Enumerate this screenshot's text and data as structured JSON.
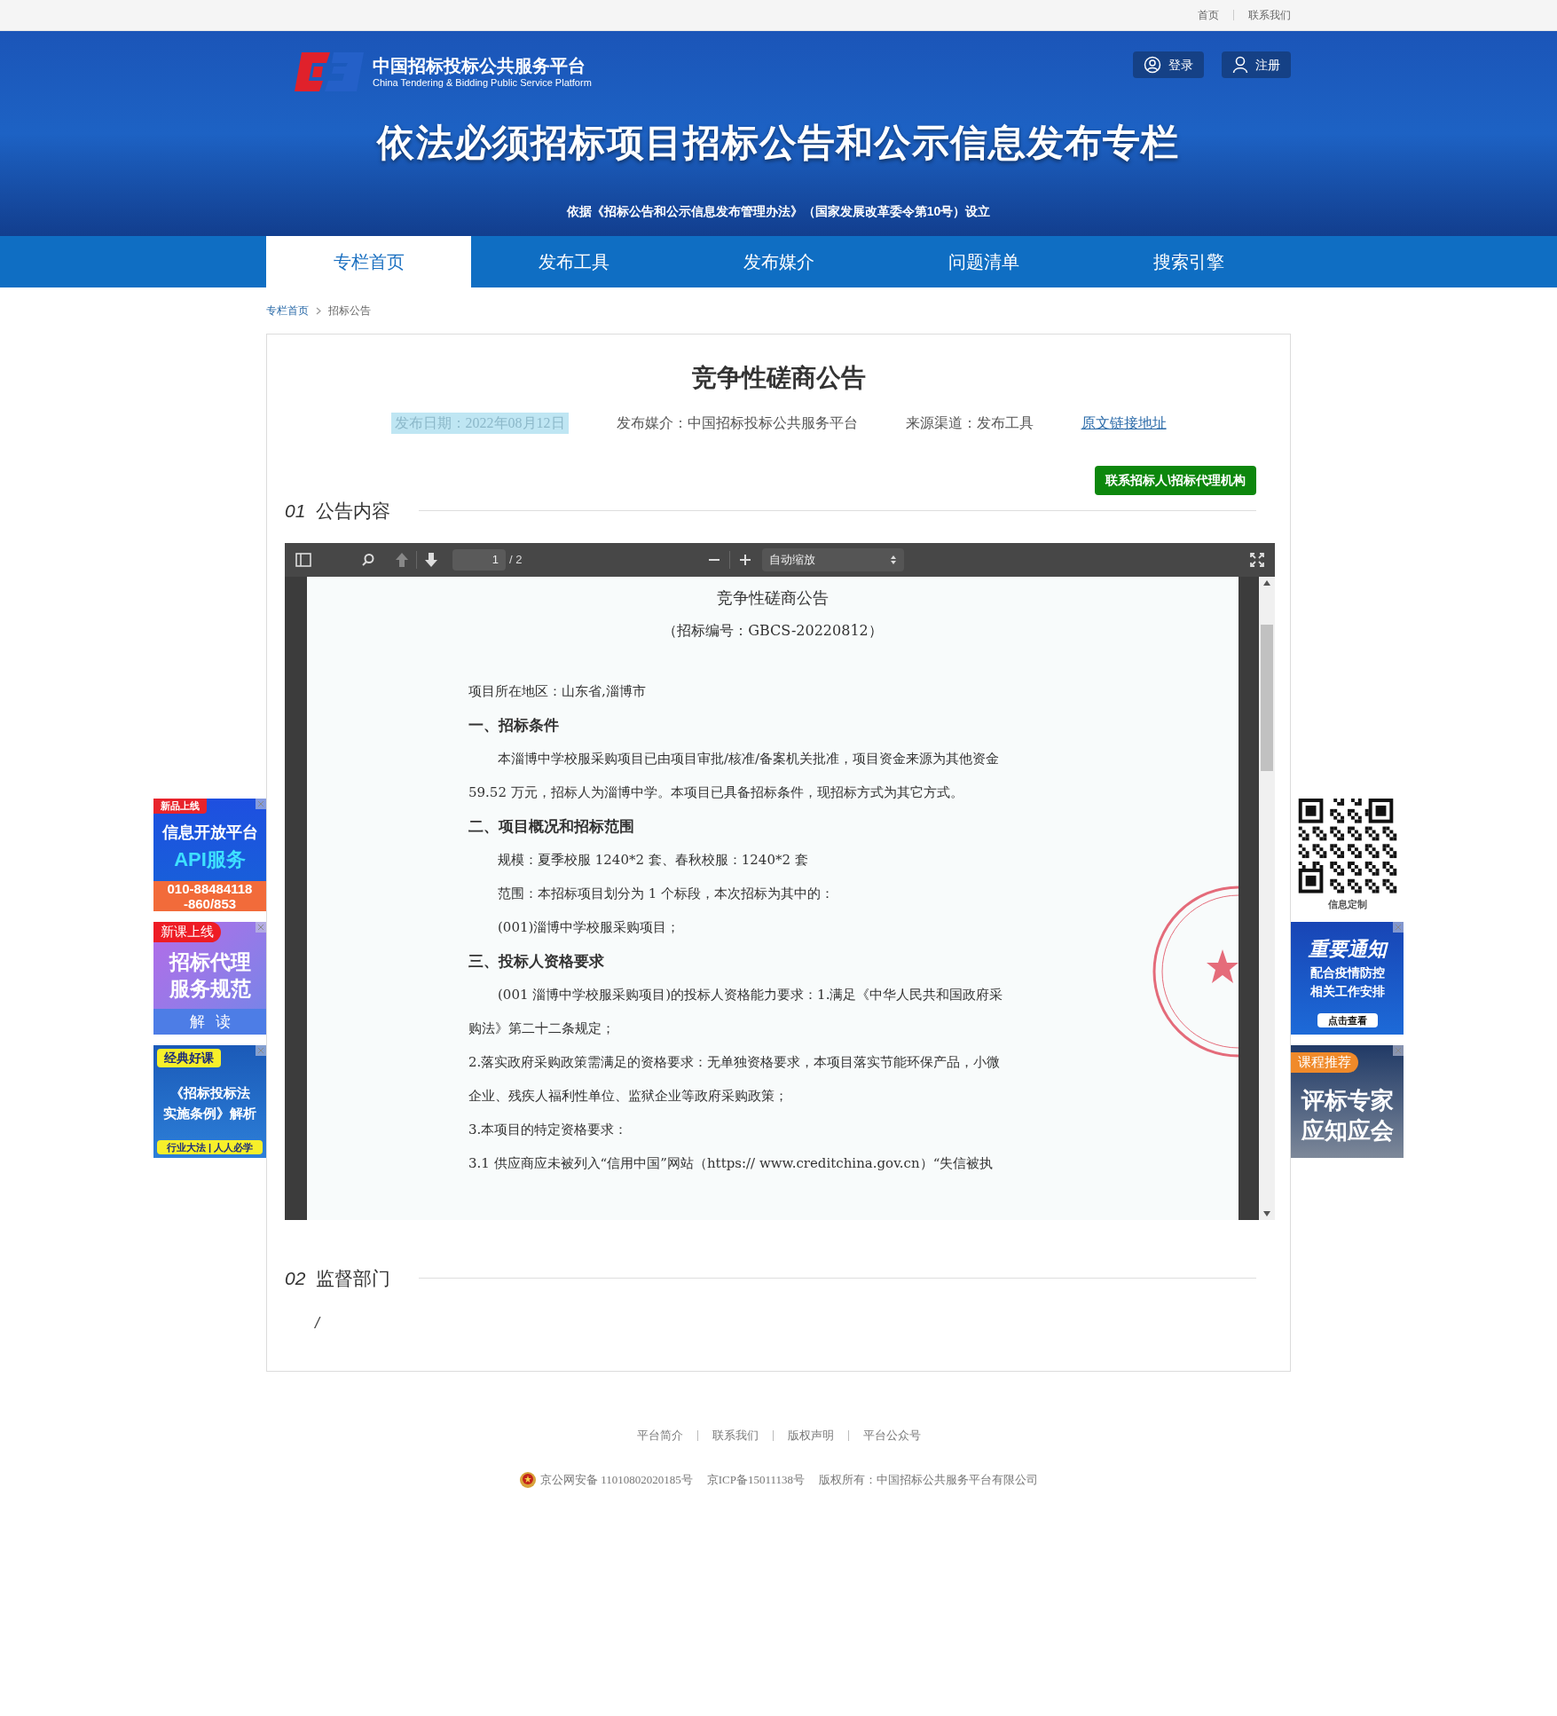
{
  "top_bar": {
    "links": [
      "首页",
      "联系我们"
    ]
  },
  "header": {
    "logo_cn": "中国招标投标公共服务平台",
    "logo_en": "China Tendering & Bidding Public Service Platform",
    "title": "依法必须招标项目招标公告和公示信息发布专栏",
    "subtitle": "依据《招标公告和公示信息发布管理办法》（国家发展改革委令第10号）设立",
    "buttons": [
      {
        "label": "登录",
        "kind": "login"
      },
      {
        "label": "注册",
        "kind": "register"
      }
    ]
  },
  "nav": [
    {
      "label": "专栏首页",
      "selected": true
    },
    {
      "label": "发布工具",
      "selected": false
    },
    {
      "label": "发布媒介",
      "selected": false
    },
    {
      "label": "问题清单",
      "selected": false
    },
    {
      "label": "搜索引擎",
      "selected": false
    }
  ],
  "breadcrumb": [
    {
      "label": "专栏首页",
      "kind": "link"
    },
    {
      "label": "招标公告",
      "kind": "current"
    }
  ],
  "notice": {
    "title": "竞争性磋商公告",
    "meta": [
      {
        "kind": "date",
        "text": "发布日期：2022年08月12日"
      },
      {
        "kind": "text",
        "text": "发布媒介：中国招标投标公共服务平台"
      },
      {
        "kind": "text",
        "text": "来源渠道：发布工具"
      },
      {
        "kind": "link",
        "text": "原文链接地址"
      }
    ],
    "contact_button": "联系招标人\\招标代理机构"
  },
  "sections": [
    {
      "number": "01",
      "title": "公告内容",
      "kind": "pdf"
    },
    {
      "number": "02",
      "title": "监督部门",
      "kind": "text",
      "body": "/"
    }
  ],
  "pdf_viewer": {
    "page": "1",
    "page_count": "/ 2",
    "zoom": "自动缩放",
    "lines": [
      {
        "kind": "title",
        "text": "竞争性磋商公告"
      },
      {
        "kind": "center",
        "text": "（招标编号：GBCS-20220812）"
      },
      {
        "kind": "plain",
        "text": "项目所在地区：山东省,淄博市"
      },
      {
        "kind": "heading",
        "text": "一、招标条件"
      },
      {
        "kind": "indent",
        "text": "本淄博中学校服采购项目已由项目审批/核准/备案机关批准，项目资金来源为其他资金"
      },
      {
        "kind": "plain",
        "text": "59.52 万元，招标人为淄博中学。本项目已具备招标条件，现招标方式为其它方式。"
      },
      {
        "kind": "heading",
        "text": "二、项目概况和招标范围"
      },
      {
        "kind": "indent",
        "text": "规模：夏季校服 1240*2 套、春秋校服：1240*2 套"
      },
      {
        "kind": "indent",
        "text": "范围：本招标项目划分为 1 个标段，本次招标为其中的："
      },
      {
        "kind": "indent",
        "text": "(001)淄博中学校服采购项目；"
      },
      {
        "kind": "heading",
        "text": "三、投标人资格要求"
      },
      {
        "kind": "indent",
        "text": "(001 淄博中学校服采购项目)的投标人资格能力要求：1.满足《中华人民共和国政府采"
      },
      {
        "kind": "plain",
        "text": "购法》第二十二条规定；"
      },
      {
        "kind": "plain",
        "text": "2.落实政府采购政策需满足的资格要求：无单独资格要求，本项目落实节能环保产品，小微"
      },
      {
        "kind": "plain",
        "text": "企业、残疾人福利性单位、监狱企业等政府采购政策；"
      },
      {
        "kind": "plain",
        "text": "3.本项目的特定资格要求："
      },
      {
        "kind": "plain",
        "text": "3.1 供应商应未被列入“信用中国”网站（https:// www.creditchina.gov.cn）“失信被执"
      }
    ]
  },
  "left_ads": [
    {
      "kind": "api",
      "tag": "新品上线",
      "lines": [
        "信息开放平台",
        "API服务"
      ],
      "footer": [
        "010-88484118",
        "-860/853"
      ]
    },
    {
      "kind": "course",
      "tag": "新课上线",
      "lines": [
        "招标代理",
        "服务规范"
      ],
      "footer": [
        "解",
        "读"
      ]
    },
    {
      "kind": "classic",
      "tag": "经典好课",
      "lines": [
        "《招标投标法",
        "实施条例》解析"
      ],
      "footer": [
        "行业大法 | 人人必学"
      ]
    }
  ],
  "right_ads": [
    {
      "kind": "qr",
      "footer": [
        "信息定制"
      ]
    },
    {
      "kind": "notice",
      "lines": [
        "重要通知",
        "配合疫情防控",
        "相关工作安排"
      ],
      "footer": [
        "点击查看"
      ]
    },
    {
      "kind": "expert",
      "tag": "课程推荐",
      "lines": [
        "评标专家",
        "应知应会"
      ]
    }
  ],
  "footer": {
    "links": [
      "平台简介",
      "联系我们",
      "版权声明",
      "平台公众号"
    ],
    "copyright": [
      "京公网安备 11010802020185号",
      "京ICP备15011138号",
      "版权所有：中国招标公共服务平台有限公司"
    ]
  }
}
